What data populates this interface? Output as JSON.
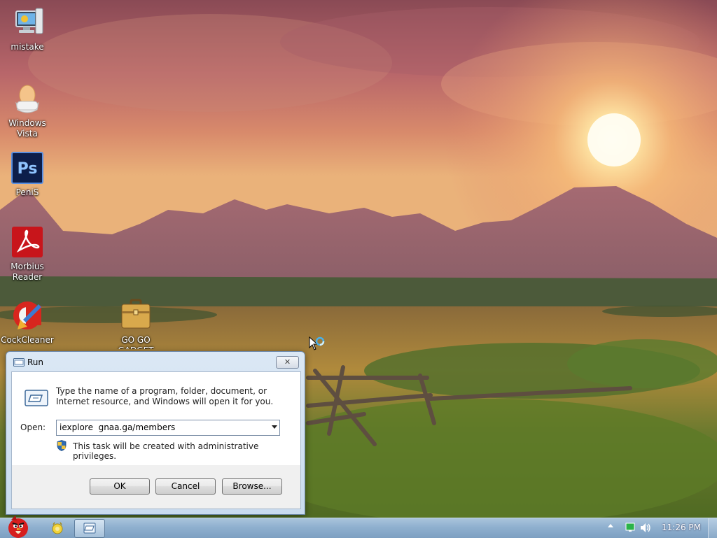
{
  "desktop": {
    "icons": [
      {
        "label": "mistake"
      },
      {
        "label": "Windows Vista"
      },
      {
        "label": "PeniS"
      },
      {
        "label": "Morbius Reader"
      },
      {
        "label": "CockCleaner"
      },
      {
        "label": "GO GO GADGET"
      }
    ]
  },
  "run_dialog": {
    "title": "Run",
    "close_label": "✕",
    "description": "Type the name of a program, folder, document, or Internet resource, and Windows will open it for you.",
    "open_label": "Open:",
    "open_value": "iexplore  gnaa.ga/members",
    "admin_note": "This task will be created with administrative privileges.",
    "buttons": {
      "ok": "OK",
      "cancel": "Cancel",
      "browse": "Browse..."
    }
  },
  "taskbar": {
    "clock": "11:26 PM"
  },
  "colors": {
    "taskbar": "#8fb0cf",
    "dialog_frame": "#c9dbee"
  }
}
